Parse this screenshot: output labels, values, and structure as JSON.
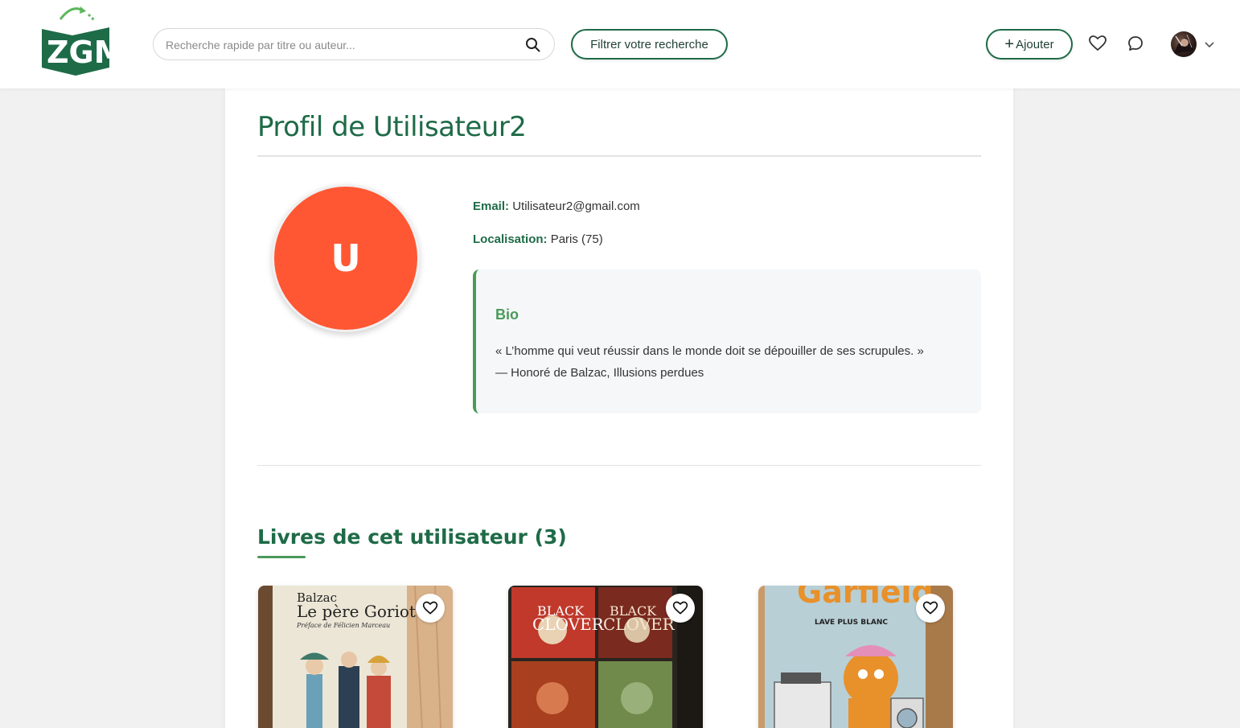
{
  "header": {
    "logo_text": "ZGM",
    "search_placeholder": "Recherche rapide par titre ou auteur...",
    "filter_label": "Filtrer votre recherche",
    "add_label": "Ajouter",
    "add_plus": "+"
  },
  "profile": {
    "title": "Profil de Utilisateur2",
    "avatar_initial": "U",
    "avatar_color": "#ff5733",
    "email_label": "Email:",
    "email_value": "Utilisateur2@gmail.com",
    "location_label": "Localisation:",
    "location_value": "Paris (75)",
    "bio_title": "Bio",
    "bio_line1": "« L’homme qui veut réussir dans le monde doit se dépouiller de ses scrupules. »",
    "bio_line2": "— Honoré de Balzac, Illusions perdues"
  },
  "books": {
    "title": "Livres de cet utilisateur (3)",
    "items": [
      {
        "cover_author": "Balzac",
        "cover_title": "Le père Goriot",
        "cover_subtitle": "Préface de Félicien Marceau"
      },
      {
        "cover_title_a": "BLACK",
        "cover_title_b": "CLOVER"
      },
      {
        "cover_title": "Garfield",
        "cover_subtitle": "LAVE PLUS BLANC"
      }
    ]
  },
  "colors": {
    "brand": "#1e6b47",
    "accent": "#4a9a5a"
  }
}
